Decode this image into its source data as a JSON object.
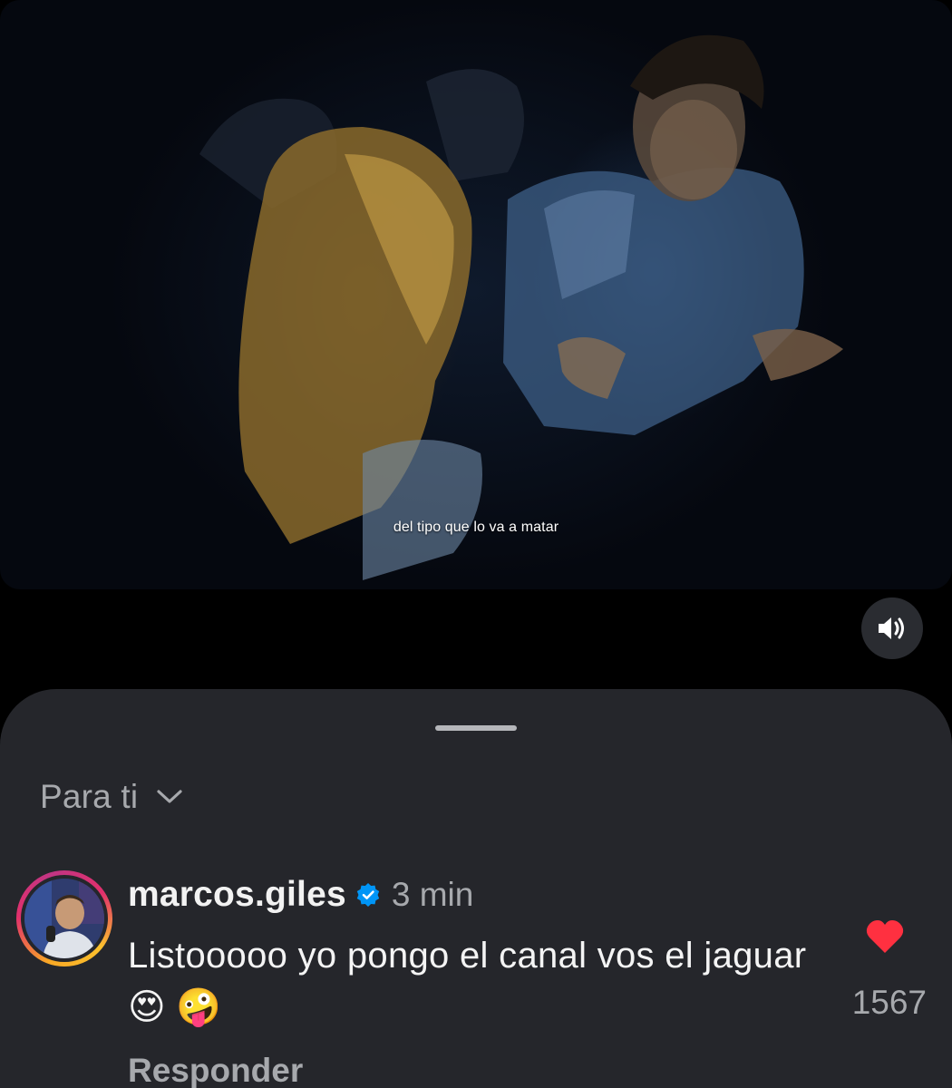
{
  "video": {
    "subtitle": "del tipo que lo va a matar",
    "mute_icon": "speaker-volume-icon"
  },
  "comments": {
    "filter_label": "Para ti",
    "filter_icon": "chevron-down-icon",
    "items": [
      {
        "username": "marcos.giles",
        "verified": true,
        "time": "3 min",
        "text": "Listooooo yo pongo el canal vos el jaguar 😍 🤪",
        "reply_label": "Responder",
        "liked": true,
        "like_count": "1567"
      }
    ]
  },
  "colors": {
    "sheet_bg": "#25262b",
    "like_red": "#ff3040",
    "verified_blue": "#0095f6",
    "muted_text": "#a7a9ad"
  }
}
